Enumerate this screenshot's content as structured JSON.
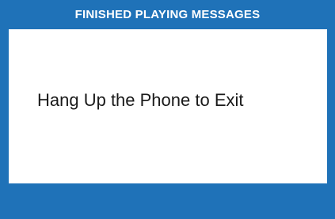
{
  "header": {
    "title": "FINISHED PLAYING MESSAGES"
  },
  "main": {
    "message": "Hang Up the Phone to Exit"
  },
  "colors": {
    "frame": "#1f72b8",
    "content_background": "#ffffff",
    "header_text": "#ffffff",
    "message_text": "#1a1a1a"
  }
}
